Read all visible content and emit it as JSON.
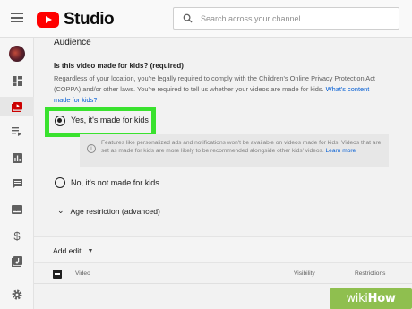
{
  "app": {
    "name": "Studio"
  },
  "search": {
    "placeholder": "Search across your channel"
  },
  "sidebar": {
    "items": [
      {
        "icon": "avatar"
      },
      {
        "icon": "dashboard-icon"
      },
      {
        "icon": "content-icon",
        "active": true
      },
      {
        "icon": "playlists-icon"
      },
      {
        "icon": "analytics-icon"
      },
      {
        "icon": "comments-icon"
      },
      {
        "icon": "subtitles-icon"
      },
      {
        "icon": "monetization-icon"
      },
      {
        "icon": "audio-library-icon"
      },
      {
        "icon": "settings-icon"
      }
    ]
  },
  "audience": {
    "title": "Audience",
    "question": "Is this video made for kids? (required)",
    "description": "Regardless of your location, you're legally required to comply with the Children's Online Privacy Protection Act (COPPA) and/or other laws. You're required to tell us whether your videos are made for kids.",
    "description_link": "What's content made for kids?",
    "option_yes": "Yes, it's made for kids",
    "option_no": "No, it's not made for kids",
    "info_text": "Features like personalized ads and notifications won't be available on videos made for kids. Videos that are set as made for kids are more likely to be recommended alongside other kids' videos.",
    "info_link": "Learn more",
    "age_restriction": "Age restriction (advanced)"
  },
  "toolbar": {
    "add_edit": "Add edit"
  },
  "table": {
    "columns": [
      "Video",
      "Visibility",
      "Restrictions"
    ]
  },
  "watermark": {
    "part1": "wiki",
    "part2": "How"
  },
  "colors": {
    "brand_red": "#ff0000",
    "highlight_green": "#39e22e",
    "link_blue": "#065fd4"
  }
}
